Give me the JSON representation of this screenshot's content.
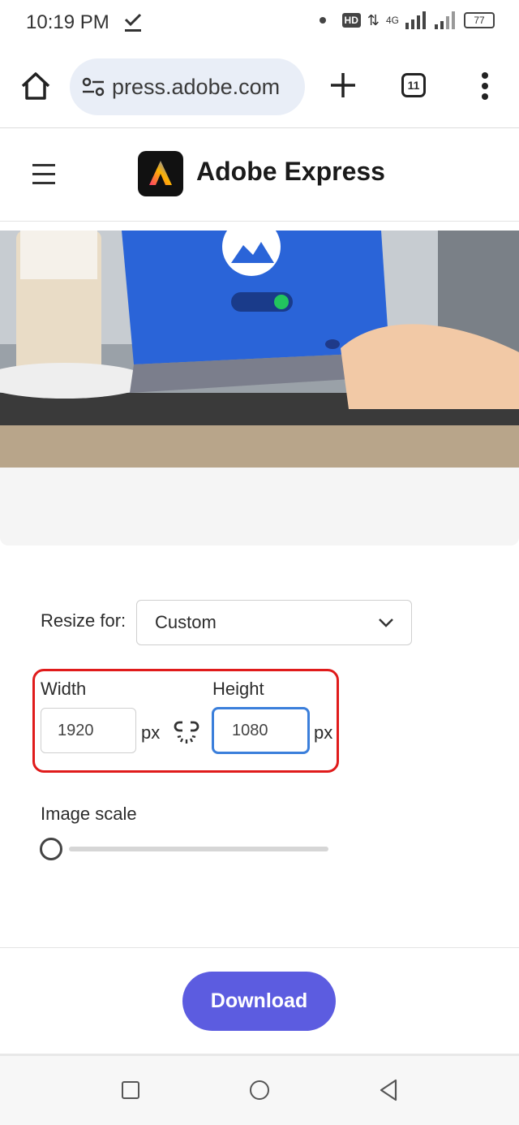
{
  "status_bar": {
    "time": "10:19 PM",
    "network_type": "4G",
    "hd_label": "HD",
    "battery": "77",
    "icons": [
      "download-done-icon",
      "dot-icon",
      "hd-icon",
      "data-transfer-icon",
      "signal-icon",
      "battery-icon"
    ]
  },
  "browser": {
    "url": "press.adobe.com",
    "tab_count": "11",
    "icons": [
      "home-icon",
      "site-settings-icon",
      "plus-icon",
      "tabs-icon",
      "more-vert-icon"
    ]
  },
  "site_header": {
    "brand": "Adobe Express",
    "icons": [
      "hamburger-icon",
      "adobe-express-logo"
    ]
  },
  "form": {
    "resize_for_label": "Resize for:",
    "resize_for_value": "Custom",
    "width_label": "Width",
    "width_value": "1920",
    "height_label": "Height",
    "height_value": "1080",
    "unit": "px",
    "image_scale_label": "Image scale",
    "image_scale_value": 0,
    "icons": [
      "chevron-down-icon",
      "unlink-icon"
    ]
  },
  "actions": {
    "download_label": "Download"
  },
  "colors": {
    "accent": "#5c5ce0",
    "highlight": "#e01b1b",
    "focus": "#3b7fdb"
  },
  "nav_bar": {
    "icons": [
      "recents-icon",
      "home-circle-icon",
      "back-icon"
    ]
  }
}
